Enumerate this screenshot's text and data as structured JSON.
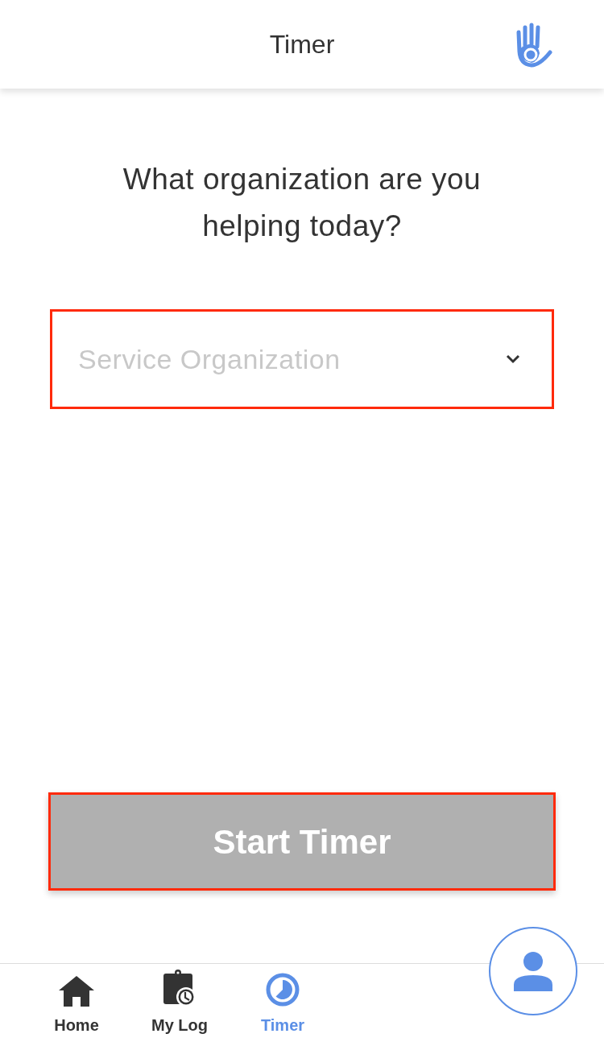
{
  "header": {
    "title": "Timer"
  },
  "question": "What organization are you helping today?",
  "organization_select": {
    "placeholder": "Service Organization"
  },
  "start_button": {
    "label": "Start Timer",
    "disabled": true
  },
  "bottom_nav": [
    {
      "kind": "home",
      "label": "Home",
      "selected": false
    },
    {
      "kind": "log",
      "label": "My Log",
      "selected": false
    },
    {
      "kind": "timer",
      "label": "Timer",
      "selected": true
    }
  ]
}
